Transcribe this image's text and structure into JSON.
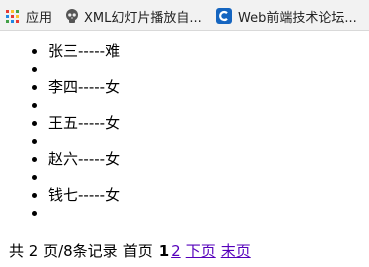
{
  "bookmarks": {
    "apps_label": "应用",
    "xml_label": "XML幻灯片播放自...",
    "web_label": "Web前端技术论坛..."
  },
  "list": {
    "items": [
      {
        "text": "张三-----难"
      },
      {
        "text": ""
      },
      {
        "text": "李四-----女"
      },
      {
        "text": ""
      },
      {
        "text": "王五-----女"
      },
      {
        "text": ""
      },
      {
        "text": "赵六-----女"
      },
      {
        "text": ""
      },
      {
        "text": "钱七-----女"
      },
      {
        "text": ""
      }
    ]
  },
  "pager": {
    "summary": "共 2 页/8条记录",
    "first_label": "首页",
    "current_page": "1",
    "page2_label": "2",
    "next_label": "下页",
    "last_label": "末页"
  }
}
